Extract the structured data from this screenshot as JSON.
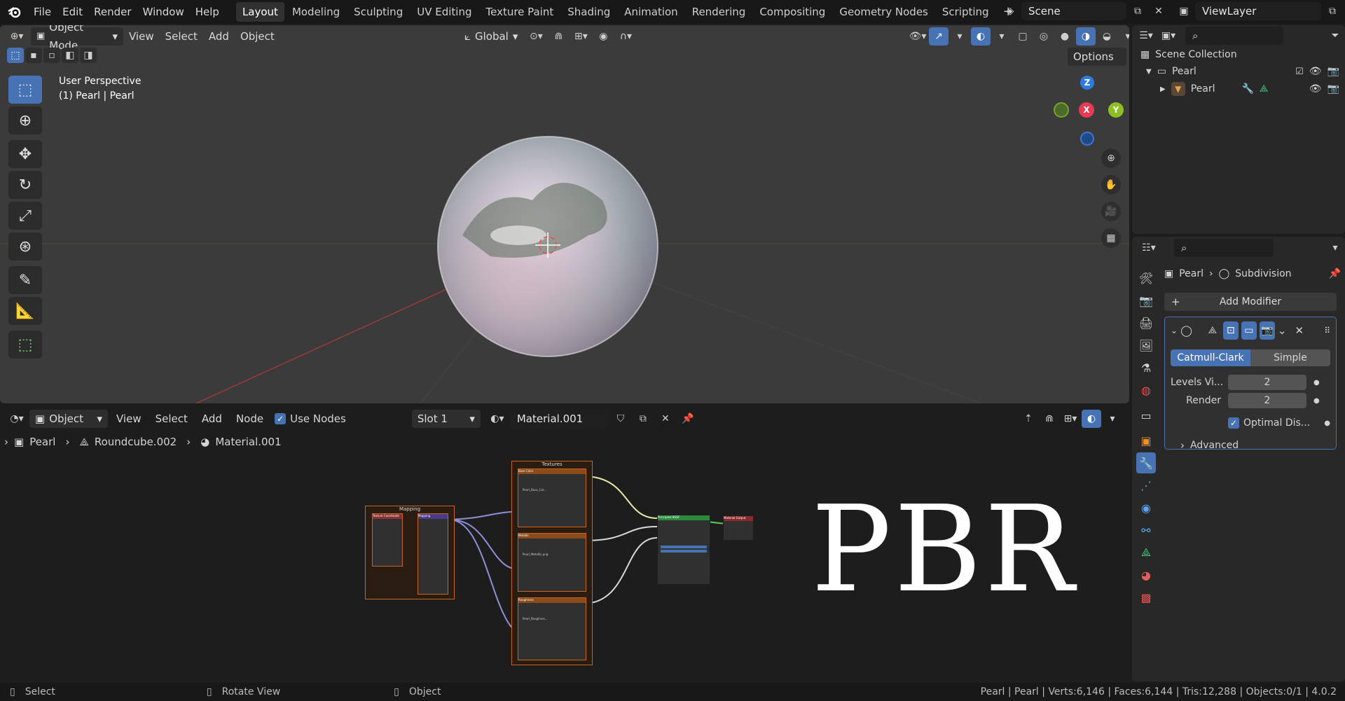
{
  "topbar": {
    "menus": [
      "File",
      "Edit",
      "Render",
      "Window",
      "Help"
    ],
    "workspaces": [
      "Layout",
      "Modeling",
      "Sculpting",
      "UV Editing",
      "Texture Paint",
      "Shading",
      "Animation",
      "Rendering",
      "Compositing",
      "Geometry Nodes",
      "Scripting"
    ],
    "active_workspace": "Layout",
    "scene": "Scene",
    "view_layer": "ViewLayer"
  },
  "viewport": {
    "mode": "Object Mode",
    "menus": [
      "View",
      "Select",
      "Add",
      "Object"
    ],
    "transform_orientation": "Global",
    "options_label": "Options",
    "overlay_title": "User Perspective",
    "overlay_sub": "(1) Pearl | Pearl",
    "gizmo": {
      "z": "Z",
      "x": "X",
      "y": "Y"
    }
  },
  "node_editor": {
    "type": "Object",
    "menus": [
      "View",
      "Select",
      "Add",
      "Node"
    ],
    "use_nodes_label": "Use Nodes",
    "slot": "Slot 1",
    "material": "Material.001",
    "breadcrumb": [
      "Pearl",
      "Roundcube.002",
      "Material.001"
    ],
    "frames": {
      "mapping": "Mapping",
      "textures": "Textures"
    },
    "nodes": {
      "texcoord": "Texture Coordinate",
      "mapping": "Mapping",
      "basecolor": "Base Color",
      "metallic": "Metallic",
      "roughness": "Roughness",
      "bsdf": "Principled BSDF",
      "output": "Material Output",
      "img1": "Pearl_Base_Col...",
      "img2": "Pearl_Metallic.png",
      "img3": "Pearl_Roughnes..."
    },
    "overlay_text": "PBR"
  },
  "outliner": {
    "root": "Scene Collection",
    "collection": "Pearl",
    "object": "Pearl"
  },
  "properties": {
    "breadcrumb_object": "Pearl",
    "breadcrumb_modifier": "Subdivision",
    "add_modifier": "Add Modifier",
    "catmull": "Catmull-Clark",
    "simple": "Simple",
    "levels_label": "Levels Vi...",
    "levels_value": "2",
    "render_label": "Render",
    "render_value": "2",
    "optimal_label": "Optimal Dis...",
    "advanced": "Advanced"
  },
  "statusbar": {
    "select": "Select",
    "rotate": "Rotate View",
    "object": "Object",
    "stats": "Pearl | Pearl | Verts:6,146 | Faces:6,144 | Tris:12,288 | Objects:0/1 | 4.0.2"
  },
  "colors": {
    "accent": "#4772b3",
    "frame": "#c8641e",
    "gizmo_x": "#e83a52",
    "gizmo_y": "#8bbf22",
    "gizmo_z": "#2e7be0"
  }
}
